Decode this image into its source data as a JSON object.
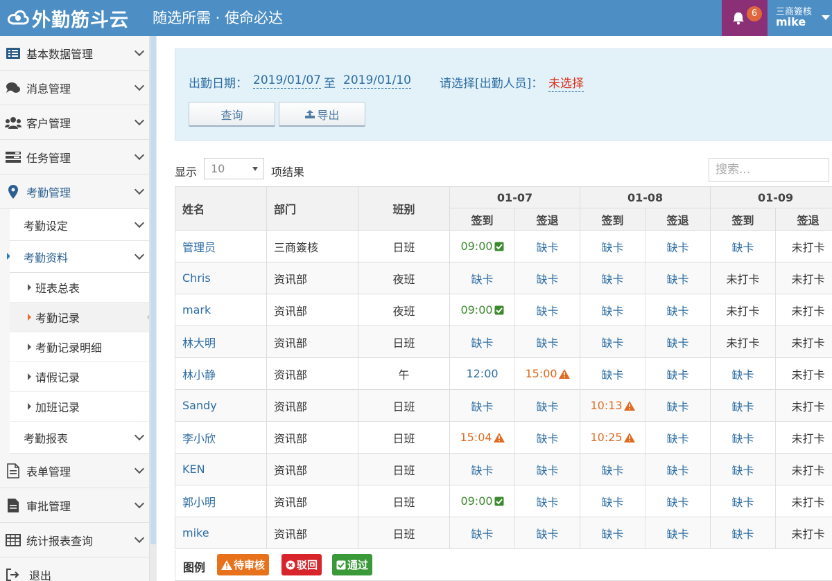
{
  "header": {
    "brand": "外勤筋斗云",
    "slogan": "随选所需 · 使命必达",
    "notification_count": "6",
    "company": "三商簽核",
    "username": "mike"
  },
  "sidebar": {
    "items": [
      {
        "label": "基本数据管理",
        "icon": "list-icon"
      },
      {
        "label": "消息管理",
        "icon": "chat-icon"
      },
      {
        "label": "客户管理",
        "icon": "users-icon"
      },
      {
        "label": "任务管理",
        "icon": "tasks-icon"
      },
      {
        "label": "考勤管理",
        "icon": "map-marker-icon"
      },
      {
        "label": "表单管理",
        "icon": "form-icon"
      },
      {
        "label": "审批管理",
        "icon": "approval-icon"
      },
      {
        "label": "统计报表查询",
        "icon": "table-icon"
      },
      {
        "label": "退出",
        "icon": "logout-icon"
      }
    ],
    "attendance_sub": [
      "考勤设定",
      "考勤资料",
      "考勤报表"
    ],
    "attendance_data_leaves": [
      "班表总表",
      "考勤记录",
      "考勤记录明细",
      "请假记录",
      "加班记录"
    ]
  },
  "filter": {
    "date_label": "出勤日期：",
    "date_from": "2019/01/07",
    "date_sep": "至",
    "date_to": "2019/01/10",
    "person_label": "请选择[出勤人员]：",
    "person_value": "未选择",
    "query_button": "查询",
    "export_button": "导出"
  },
  "table_controls": {
    "show_label": "显示",
    "page_size": "10",
    "result_label": "项结果",
    "search_placeholder": "搜索..."
  },
  "table": {
    "headers": {
      "name": "姓名",
      "dept": "部门",
      "shift": "班别",
      "in": "签到",
      "out": "签退"
    },
    "dates": [
      "01-07",
      "01-08",
      "01-09"
    ],
    "rows": [
      {
        "name": "管理员",
        "dept": "三商簽核",
        "shift": "日班",
        "cells": [
          [
            "09:00",
            "ok"
          ],
          [
            "缺卡",
            "absent"
          ],
          [
            "缺卡",
            "absent"
          ],
          [
            "缺卡",
            "absent"
          ],
          [
            "缺卡",
            "absent"
          ],
          [
            "未打卡",
            "none"
          ]
        ]
      },
      {
        "name": "Chris",
        "dept": "资讯部",
        "shift": "夜班",
        "cells": [
          [
            "缺卡",
            "absent"
          ],
          [
            "缺卡",
            "absent"
          ],
          [
            "缺卡",
            "absent"
          ],
          [
            "缺卡",
            "absent"
          ],
          [
            "未打卡",
            "none"
          ],
          [
            "未打卡",
            "none"
          ]
        ]
      },
      {
        "name": "mark",
        "dept": "资讯部",
        "shift": "夜班",
        "cells": [
          [
            "09:00",
            "ok"
          ],
          [
            "缺卡",
            "absent"
          ],
          [
            "缺卡",
            "absent"
          ],
          [
            "缺卡",
            "absent"
          ],
          [
            "未打卡",
            "none"
          ],
          [
            "未打卡",
            "none"
          ]
        ]
      },
      {
        "name": "林大明",
        "dept": "资讯部",
        "shift": "日班",
        "cells": [
          [
            "缺卡",
            "absent"
          ],
          [
            "缺卡",
            "absent"
          ],
          [
            "缺卡",
            "absent"
          ],
          [
            "缺卡",
            "absent"
          ],
          [
            "未打卡",
            "none"
          ],
          [
            "未打卡",
            "none"
          ]
        ]
      },
      {
        "name": "林小静",
        "dept": "资讯部",
        "shift": "午",
        "cells": [
          [
            "12:00",
            "plain"
          ],
          [
            "15:00",
            "warn"
          ],
          [
            "缺卡",
            "absent"
          ],
          [
            "缺卡",
            "absent"
          ],
          [
            "缺卡",
            "absent"
          ],
          [
            "未打卡",
            "none"
          ]
        ]
      },
      {
        "name": "Sandy",
        "dept": "资讯部",
        "shift": "日班",
        "cells": [
          [
            "缺卡",
            "absent"
          ],
          [
            "缺卡",
            "absent"
          ],
          [
            "10:13",
            "warn"
          ],
          [
            "缺卡",
            "absent"
          ],
          [
            "缺卡",
            "absent"
          ],
          [
            "未打卡",
            "none"
          ]
        ]
      },
      {
        "name": "李小欣",
        "dept": "资讯部",
        "shift": "日班",
        "cells": [
          [
            "15:04",
            "warn"
          ],
          [
            "缺卡",
            "absent"
          ],
          [
            "10:25",
            "warn"
          ],
          [
            "缺卡",
            "absent"
          ],
          [
            "缺卡",
            "absent"
          ],
          [
            "未打卡",
            "none"
          ]
        ]
      },
      {
        "name": "KEN",
        "dept": "资讯部",
        "shift": "日班",
        "cells": [
          [
            "缺卡",
            "absent"
          ],
          [
            "缺卡",
            "absent"
          ],
          [
            "缺卡",
            "absent"
          ],
          [
            "缺卡",
            "absent"
          ],
          [
            "缺卡",
            "absent"
          ],
          [
            "未打卡",
            "none"
          ]
        ]
      },
      {
        "name": "郭小明",
        "dept": "资讯部",
        "shift": "日班",
        "cells": [
          [
            "09:00",
            "ok"
          ],
          [
            "缺卡",
            "absent"
          ],
          [
            "缺卡",
            "absent"
          ],
          [
            "缺卡",
            "absent"
          ],
          [
            "缺卡",
            "absent"
          ],
          [
            "未打卡",
            "none"
          ]
        ]
      },
      {
        "name": "mike",
        "dept": "资讯部",
        "shift": "日班",
        "cells": [
          [
            "缺卡",
            "absent"
          ],
          [
            "缺卡",
            "absent"
          ],
          [
            "缺卡",
            "absent"
          ],
          [
            "缺卡",
            "absent"
          ],
          [
            "缺卡",
            "absent"
          ],
          [
            "未打卡",
            "none"
          ]
        ]
      }
    ]
  },
  "legend": {
    "title": "图例",
    "items": [
      {
        "label": "待审核",
        "color": "#e8721c",
        "icon": "warning-icon"
      },
      {
        "label": "驳回",
        "color": "#d8242b",
        "icon": "close-circle-icon"
      },
      {
        "label": "通过",
        "color": "#3a9a3a",
        "icon": "check-square-icon"
      }
    ]
  }
}
